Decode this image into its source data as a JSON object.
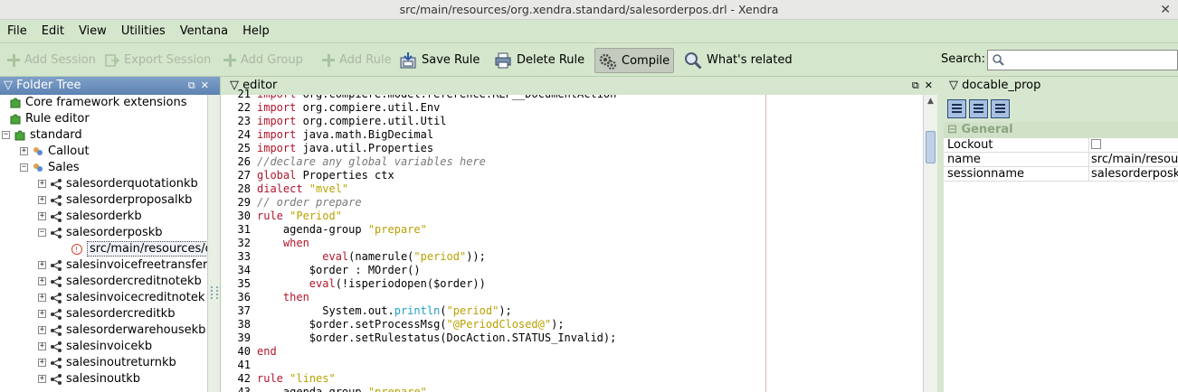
{
  "window": {
    "title": "src/main/resources/org.xendra.standard/salesorderpos.drl - Xendra",
    "close_glyph": "✕"
  },
  "menu": [
    "File",
    "Edit",
    "View",
    "Utilities",
    "Ventana",
    "Help"
  ],
  "toolbar": {
    "add_session": "Add Session",
    "export_session": "Export Session",
    "add_group": "Add Group",
    "add_rule": "Add Rule",
    "save_rule": "Save Rule",
    "delete_rule": "Delete Rule",
    "compile": "Compile",
    "whats_related": "What's related",
    "search_label": "Search:",
    "search_value": ""
  },
  "folder_tree": {
    "title": "Folder Tree",
    "items": [
      "Core framework extensions",
      "Rule editor",
      "standard",
      "Callout",
      "Sales",
      "salesorderquotationkb",
      "salesorderproposalkb",
      "salesorderkb",
      "salesorderposkb",
      "src/main/resources/o",
      "salesinvoicefreetransfer",
      "salesordercreditnotekb",
      "salesinvoicecreditnotek",
      "salesordercreditkb",
      "salesorderwarehousekb",
      "salesinvoicekb",
      "salesinoutreturnkb",
      "salesinoutkb"
    ]
  },
  "editor": {
    "title": "editor",
    "line_numbers": [
      "21",
      "22",
      "23",
      "24",
      "25",
      "26",
      "27",
      "28",
      "29",
      "30",
      "31",
      "32",
      "33",
      "34",
      "35",
      "36",
      "37",
      "38",
      "39",
      "40",
      "41",
      "42",
      "43"
    ],
    "lines": [
      "import org.compiere.model.reference.REF__DocumentAction",
      "import org.compiere.util.Env",
      "import org.compiere.util.Util",
      "import java.math.BigDecimal",
      "import java.util.Properties",
      "//declare any global variables here",
      "global Properties ctx",
      "dialect \"mvel\"",
      "// order prepare",
      "rule \"Period\"",
      "    agenda-group \"prepare\"",
      "    when",
      "          eval(namerule(\"period\"));",
      "        $order : MOrder()",
      "        eval(!isperiodopen($order))",
      "    then",
      "          System.out.println(\"period\");",
      "        $order.setProcessMsg(\"@PeriodClosed@\");",
      "        $order.setRulestatus(DocAction.STATUS_Invalid);",
      "end",
      "",
      "rule \"lines\"",
      "    agenda-group \"prepare\""
    ]
  },
  "properties": {
    "title": "docable_prop",
    "group": "General",
    "rows": [
      {
        "key": "Lockout",
        "value": ""
      },
      {
        "key": "name",
        "value": "src/main/resources/org"
      },
      {
        "key": "sessionname",
        "value": "salesorderposkb"
      }
    ]
  }
}
